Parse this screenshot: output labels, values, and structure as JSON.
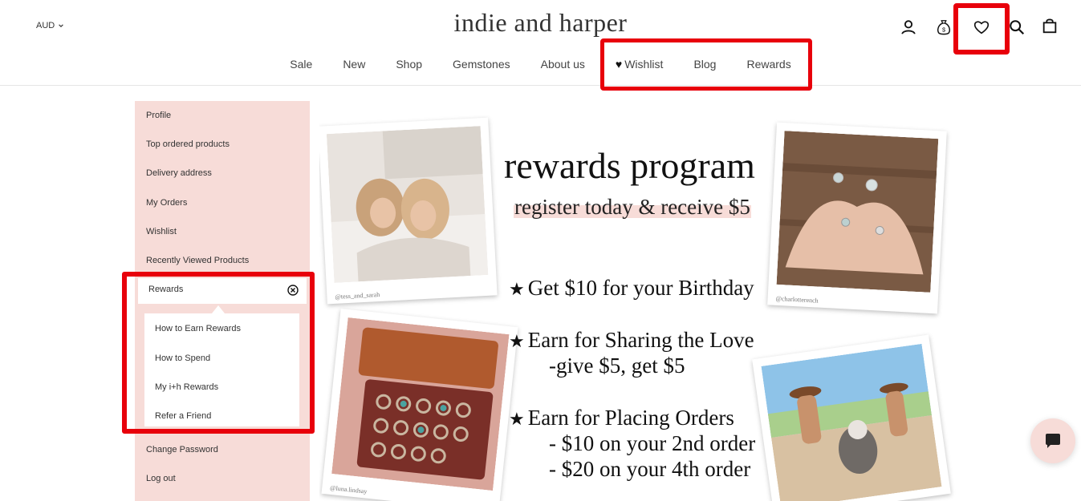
{
  "header": {
    "currency": "AUD",
    "logo": "indie and harper",
    "nav": [
      "Sale",
      "New",
      "Shop",
      "Gemstones",
      "About us",
      "Wishlist",
      "Blog",
      "Rewards"
    ]
  },
  "icons": [
    "account-icon",
    "money-bag-icon",
    "heart-icon",
    "search-icon",
    "bag-icon"
  ],
  "sidebar": {
    "items": [
      "Profile",
      "Top ordered products",
      "Delivery address",
      "My Orders",
      "Wishlist",
      "Recently Viewed Products"
    ],
    "rewards_label": "Rewards",
    "rewards_submenu": [
      "How to Earn Rewards",
      "How to Spend",
      "My i+h Rewards",
      "Refer a Friend"
    ],
    "bottom_items": [
      "Change Password",
      "Log out"
    ]
  },
  "banner": {
    "title": "rewards program",
    "subtitle": "register today & receive $5",
    "lines": [
      "Get $10 for your Birthday",
      "Earn for Sharing the Love",
      "-give $5, get $5",
      "Earn for Placing Orders",
      "- $10 on your 2nd order",
      "- $20 on your 4th order"
    ],
    "captions": [
      "@tess_and_sarah",
      "@charlotterench",
      "@luna.lindsay"
    ]
  },
  "colors": {
    "accent_pink": "#f7dcd8",
    "highlight_red": "#e8000b"
  }
}
